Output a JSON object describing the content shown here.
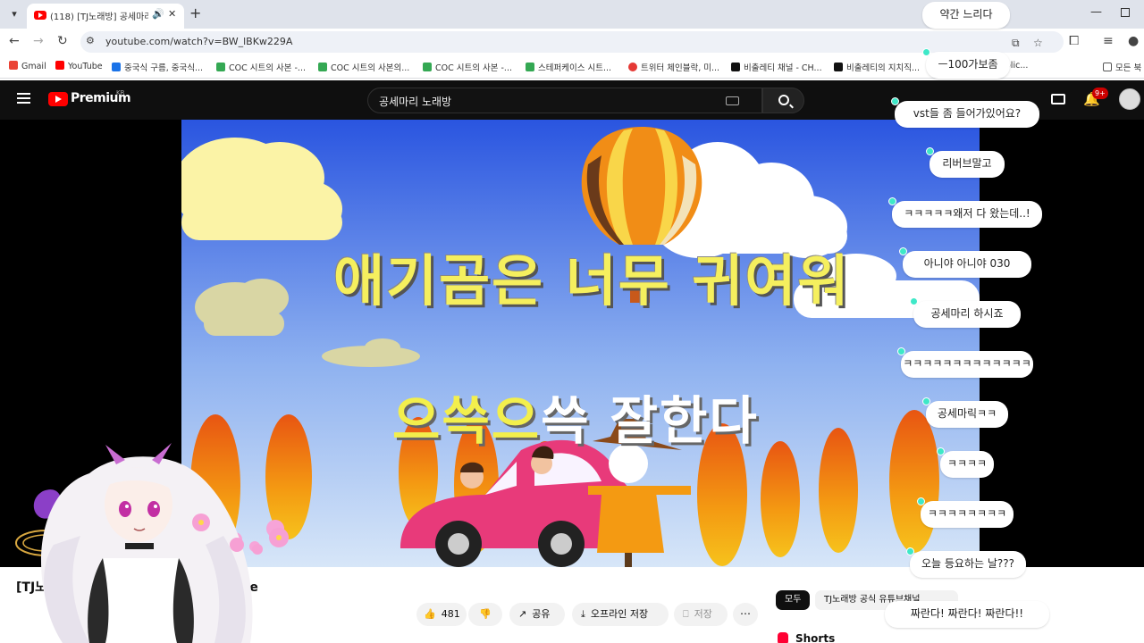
{
  "browser": {
    "tab_title": "(118) [TJ노래방] 공세마리 -",
    "url": "youtube.com/watch?v=BW_lBKw229A",
    "bookmarks": [
      {
        "label": "Gmail",
        "color": "#ea4335"
      },
      {
        "label": "YouTube",
        "color": "#ff0000"
      },
      {
        "label": "중국식 구름, 중국식...",
        "color": "#1a73e8"
      },
      {
        "label": "COC 시트의 사본 -...",
        "color": "#34a853"
      },
      {
        "label": "COC 시트의 사본의...",
        "color": "#34a853"
      },
      {
        "label": "COC 시트의 사본 -...",
        "color": "#34a853"
      },
      {
        "label": "스테퍼케이스 시트...",
        "color": "#34a853"
      },
      {
        "label": "트위터 체인블락, 미...",
        "color": "#e53935"
      },
      {
        "label": "비출레티 채널 - CH...",
        "color": "#111111"
      },
      {
        "label": "비출레티의 지치직...",
        "color": "#111111"
      }
    ],
    "bookmark_overflow": "olic...",
    "other_bookmarks": "모든 북"
  },
  "youtube": {
    "logo_text": "Premium",
    "region": "KR",
    "search_value": "공세마리 노래방",
    "notif_count": "9+"
  },
  "video": {
    "lyric_line_1": "애기곰은 너무 귀여워",
    "lyric_line_2_sung": "으쓱으",
    "lyric_line_2_rest": "쓱 잘한다",
    "colors": {
      "sky_top": "#2a55e0",
      "sky_bottom": "#cfe0f7",
      "car": "#e83a7a",
      "lyric_yellow": "#f5ef5e"
    }
  },
  "below": {
    "title_prefix": "[TJ노",
    "title_suffix": "araoke",
    "like_count": "481",
    "share": "공유",
    "offline_save": "오프라인 저장",
    "save": "저장",
    "more": "⋯",
    "chip_all": "모두",
    "chip_channel": "TJ노래방 공식 유튜브채널",
    "shorts": "Shorts"
  },
  "chat": [
    {
      "text": "약간 느리다",
      "dot": false
    },
    {
      "text": "ㅡ100가보좀",
      "dot": true
    },
    {
      "text": "vst들 좀 들어가있어요?",
      "dot": true
    },
    {
      "text": "리버브말고",
      "dot": true
    },
    {
      "text": "ㅋㅋㅋㅋㅋ왜저 다 왔는데..!",
      "dot": true
    },
    {
      "text": "아니야 아니야 030",
      "dot": true
    },
    {
      "text": "공세마리 하시죠",
      "dot": true
    },
    {
      "text": "ㅋㅋㅋㅋㅋㅋㅋㅋㅋㅋㅋㅋㅋ",
      "dot": true
    },
    {
      "text": "공세마릭ㅋㅋ",
      "dot": true
    },
    {
      "text": "ㅋㅋㅋㅋ",
      "dot": true
    },
    {
      "text": "ㅋㅋㅋㅋㅋㅋㅋㅋ",
      "dot": true
    },
    {
      "text": "오늘 등요하는 날???",
      "dot": true
    },
    {
      "text": "짜란다! 짜란다! 짜란다!!",
      "dot": false
    }
  ]
}
